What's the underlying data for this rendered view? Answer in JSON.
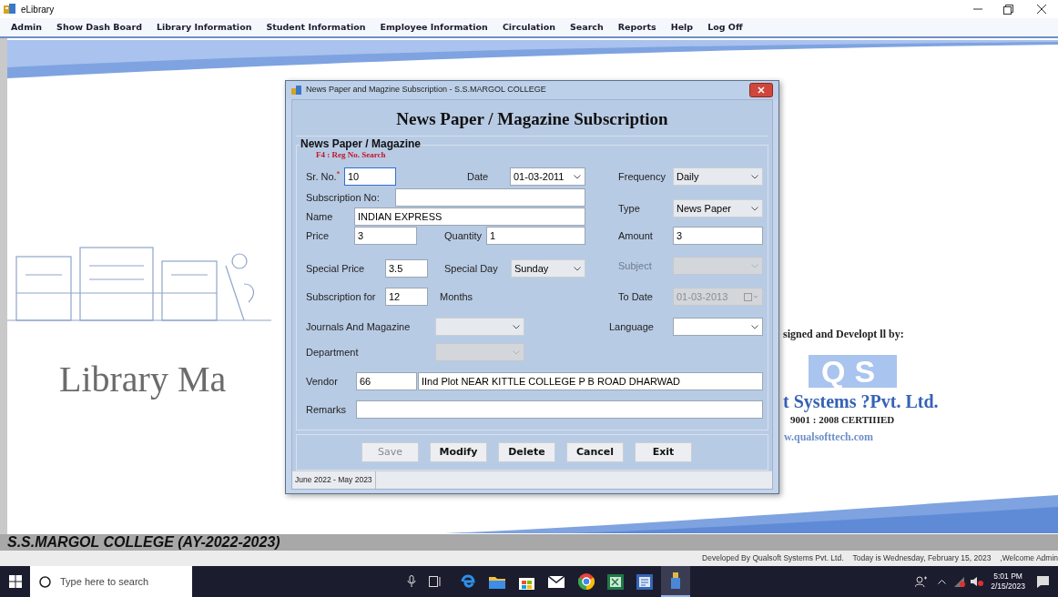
{
  "window": {
    "title": "eLibrary"
  },
  "menu": [
    "Admin",
    "Show Dash Board",
    "Library Information",
    "Student Information",
    "Employee Information",
    "Circulation",
    "Search",
    "Reports",
    "Help",
    "Log Off"
  ],
  "background": {
    "title_fragment": "Library Ma",
    "credit_heading": "signed and Developt ll by:",
    "logo": "QS",
    "company": "t Systems ?Pvt. Ltd.",
    "certification": "9001 : 2008 CERTIIIED",
    "website": "w.qualsofttech.com"
  },
  "dialog": {
    "title": "News Paper and Magzine Subscription - S.S.MARGOL COLLEGE",
    "heading": "News Paper / Magazine Subscription",
    "group_title": "News Paper / Magazine",
    "hint": "F4 : Reg No. Search",
    "left_rows": [
      [
        {
          "kind": "label",
          "text": "Sr. No.",
          "required_mark": "*"
        },
        {
          "kind": "text",
          "value": "10",
          "focused": true
        },
        {
          "kind": "label",
          "text": "Date"
        },
        {
          "kind": "date",
          "value": "01-03-2011",
          "disabled": false
        }
      ],
      [
        {
          "kind": "label",
          "text": "Subscription No:"
        },
        {
          "kind": "text"
        }
      ],
      [
        {
          "kind": "label",
          "text": "Name"
        },
        {
          "kind": "text",
          "value": "INDIAN EXPRESS"
        }
      ],
      [
        {
          "kind": "label",
          "text": "Price"
        },
        {
          "kind": "text",
          "value": "3"
        },
        {
          "kind": "label",
          "text": "Quantity"
        },
        {
          "kind": "text",
          "value": "1"
        }
      ],
      [
        {
          "kind": "label",
          "text": "Special Price"
        },
        {
          "kind": "text",
          "value": "3.5"
        },
        {
          "kind": "label",
          "text": "Special Day"
        },
        {
          "kind": "combo",
          "value": "Sunday",
          "disabled": false,
          "dropdown_list": true
        }
      ],
      [
        {
          "kind": "label",
          "text": "Subscription for"
        },
        {
          "kind": "text",
          "value": "12"
        },
        {
          "kind": "label",
          "text": "Months"
        }
      ]
    ],
    "right_rows": [
      [
        {
          "kind": "label",
          "text": "Frequency"
        },
        {
          "kind": "combo",
          "value": "Daily",
          "disabled": false,
          "dropdown_list": true
        }
      ],
      [
        {
          "kind": "label",
          "text": "Type"
        },
        {
          "kind": "combo",
          "value": "News Paper",
          "disabled": false,
          "dropdown_list": true
        }
      ],
      [
        {
          "kind": "label",
          "text": "Amount"
        },
        {
          "kind": "text",
          "value": "3"
        }
      ],
      [
        {
          "kind": "label",
          "text": "Subject",
          "disabled": true
        },
        {
          "kind": "combo",
          "disabled": true
        }
      ],
      [
        {
          "kind": "label",
          "text": "To Date"
        },
        {
          "kind": "date",
          "value": "01-03-2013",
          "disabled": true
        }
      ]
    ],
    "bottom_rows": [
      [
        {
          "kind": "label",
          "text": "Journals And Magazine"
        },
        {
          "kind": "combo",
          "disabled": false,
          "dropdown_list": true
        },
        {
          "kind": "label",
          "text": "Language"
        },
        {
          "kind": "combo",
          "disabled": false,
          "dropdown_list": false
        }
      ],
      [
        {
          "kind": "label",
          "text": "Department"
        },
        {
          "kind": "combo",
          "disabled": true
        }
      ],
      [
        {
          "kind": "label",
          "text": "Vendor"
        },
        {
          "kind": "text",
          "value": "66"
        },
        {
          "kind": "text",
          "value": "IInd Plot NEAR KITTLE COLLEGE P B ROAD DHARWAD"
        }
      ],
      [
        {
          "kind": "label",
          "text": "Remarks"
        },
        {
          "kind": "text"
        }
      ]
    ],
    "buttons": [
      {
        "label": "Save",
        "disabled": true
      },
      {
        "label": "Modify",
        "disabled": false
      },
      {
        "label": "Delete",
        "disabled": false
      },
      {
        "label": "Cancel",
        "disabled": false
      },
      {
        "label": "Exit",
        "disabled": false
      }
    ],
    "status": "June 2022 - May 2023"
  },
  "footer": {
    "college": "S.S.MARGOL COLLEGE (AY-2022-2023)",
    "status_texts": [
      "Developed By Qualsoft Systems Pvt. Ltd.",
      "Today is Wednesday, February 15, 2023",
      ",Welcome Admin"
    ]
  },
  "taskbar": {
    "search_placeholder": "Type here to search",
    "time": "5:01 PM",
    "date": "2/15/2023"
  }
}
